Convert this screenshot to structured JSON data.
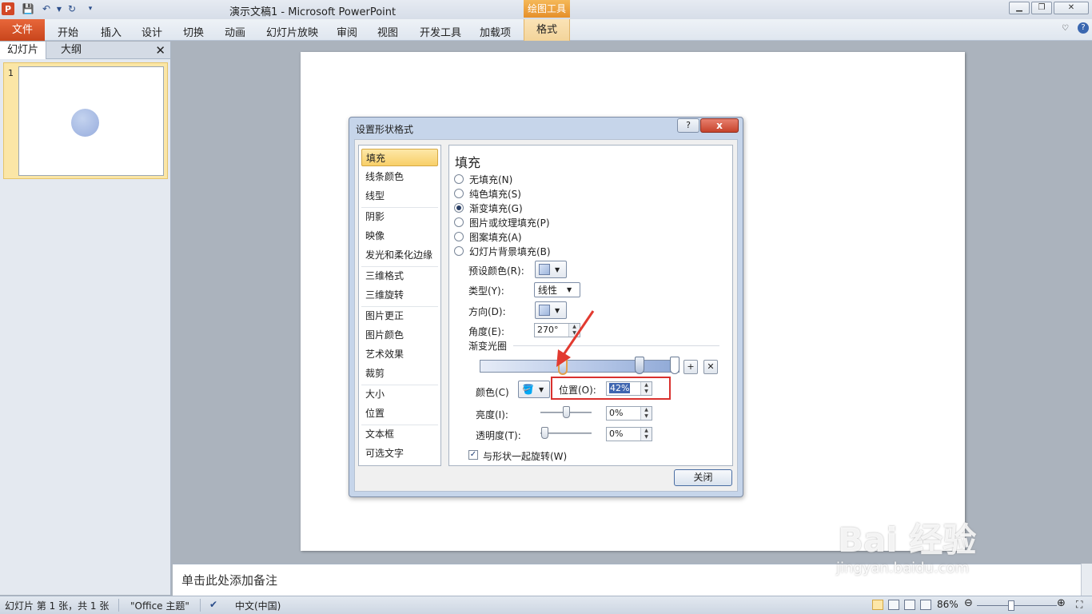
{
  "titlebar": {
    "app_icon": "P",
    "title": "演示文稿1  -  Microsoft PowerPoint",
    "context_group": "绘图工具"
  },
  "ribbon": {
    "file": "文件",
    "tabs": [
      "开始",
      "插入",
      "设计",
      "切换",
      "动画",
      "幻灯片放映",
      "审阅",
      "视图",
      "开发工具",
      "加载项"
    ],
    "format": "格式"
  },
  "left_panel": {
    "tab_slides": "幻灯片",
    "tab_outline": "大纲",
    "slide_number": "1"
  },
  "notes": {
    "placeholder": "单击此处添加备注"
  },
  "dialog": {
    "title": "设置形状格式",
    "help": "?",
    "close_x": "x",
    "categories": [
      "填充",
      "线条颜色",
      "线型",
      "阴影",
      "映像",
      "发光和柔化边缘",
      "三维格式",
      "三维旋转",
      "图片更正",
      "图片颜色",
      "艺术效果",
      "裁剪",
      "大小",
      "位置",
      "文本框",
      "可选文字"
    ],
    "pane_heading": "填充",
    "fill_options": [
      "无填充(N)",
      "纯色填充(S)",
      "渐变填充(G)",
      "图片或纹理填充(P)",
      "图案填充(A)",
      "幻灯片背景填充(B)"
    ],
    "selected_fill": "渐变填充(G)",
    "preset_label": "预设颜色(R):",
    "type_label": "类型(Y):",
    "type_value": "线性",
    "direction_label": "方向(D):",
    "angle_label": "角度(E):",
    "angle_value": "270°",
    "stops_label": "渐变光圈",
    "color_label": "颜色(C)",
    "position_label": "位置(O):",
    "position_value": "42%",
    "brightness_label": "亮度(I):",
    "brightness_value": "0%",
    "transparency_label": "透明度(T):",
    "transparency_value": "0%",
    "rotate_label": "与形状一起旋转(W)",
    "rotate_checked": true,
    "close_button": "关闭"
  },
  "statusbar": {
    "slide_info": "幻灯片 第 1 张，共 1 张",
    "theme": "\"Office 主题\"",
    "language": "中文(中国)",
    "zoom": "86%"
  },
  "watermark": {
    "brand": "Bai 经验",
    "url": "jingyan.baidu.com"
  }
}
